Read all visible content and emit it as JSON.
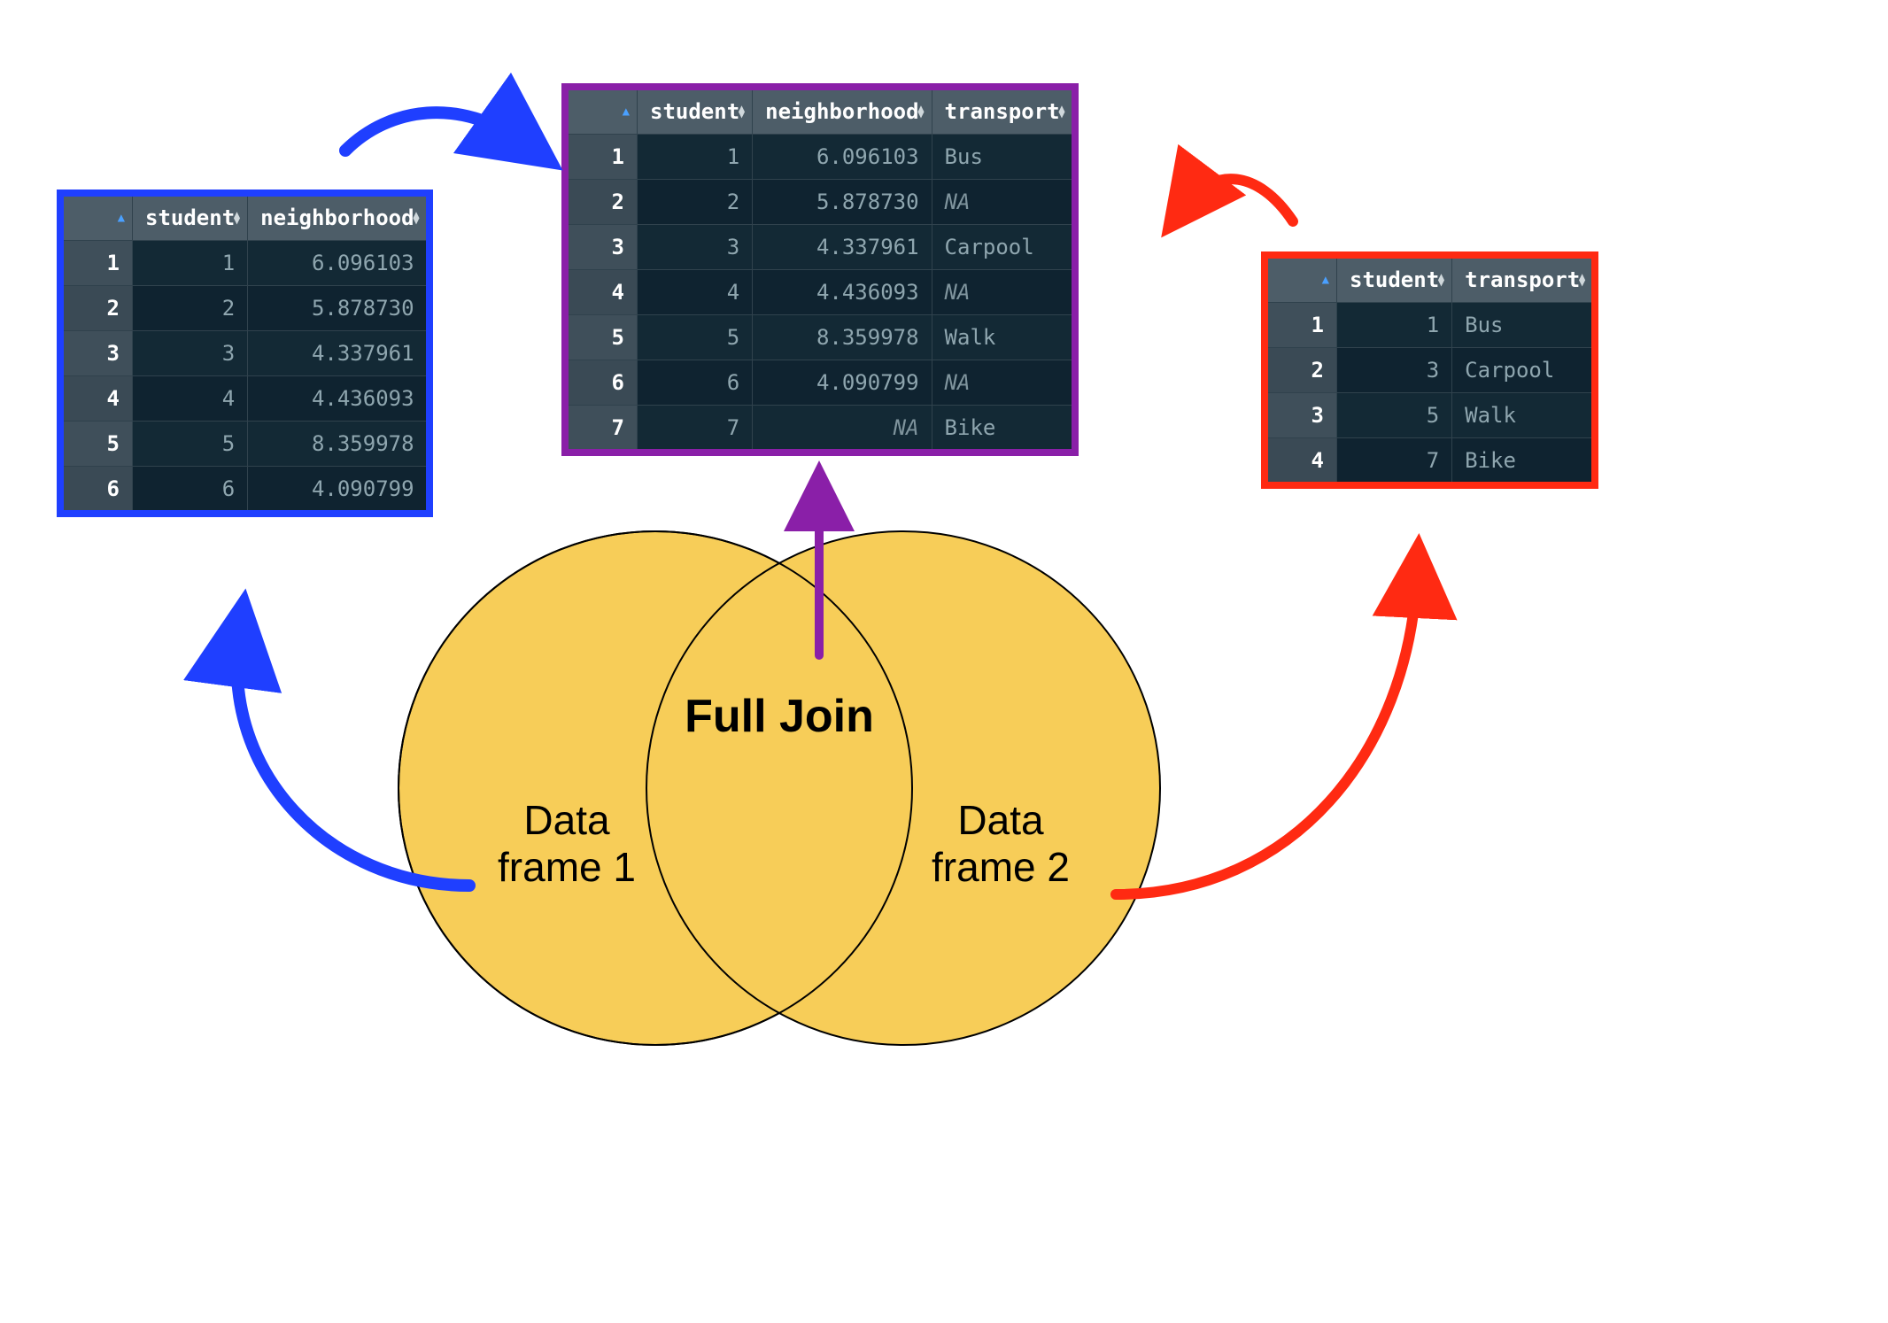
{
  "venn": {
    "center_title": "Full Join",
    "left_label": "Data\nframe 1",
    "right_label": "Data\nframe 2"
  },
  "df1": {
    "columns": [
      "student",
      "neighborhood"
    ],
    "rows": [
      {
        "n": "1",
        "student": "1",
        "neighborhood": "6.096103"
      },
      {
        "n": "2",
        "student": "2",
        "neighborhood": "5.878730"
      },
      {
        "n": "3",
        "student": "3",
        "neighborhood": "4.337961"
      },
      {
        "n": "4",
        "student": "4",
        "neighborhood": "4.436093"
      },
      {
        "n": "5",
        "student": "5",
        "neighborhood": "8.359978"
      },
      {
        "n": "6",
        "student": "6",
        "neighborhood": "4.090799"
      }
    ]
  },
  "df2": {
    "columns": [
      "student",
      "transport"
    ],
    "rows": [
      {
        "n": "1",
        "student": "1",
        "transport": "Bus"
      },
      {
        "n": "2",
        "student": "3",
        "transport": "Carpool"
      },
      {
        "n": "3",
        "student": "5",
        "transport": "Walk"
      },
      {
        "n": "4",
        "student": "7",
        "transport": "Bike"
      }
    ]
  },
  "result": {
    "columns": [
      "student",
      "neighborhood",
      "transport"
    ],
    "rows": [
      {
        "n": "1",
        "student": "1",
        "neighborhood": "6.096103",
        "transport": "Bus",
        "na": false,
        "na_n": false
      },
      {
        "n": "2",
        "student": "2",
        "neighborhood": "5.878730",
        "transport": "NA",
        "na": true,
        "na_n": false
      },
      {
        "n": "3",
        "student": "3",
        "neighborhood": "4.337961",
        "transport": "Carpool",
        "na": false,
        "na_n": false
      },
      {
        "n": "4",
        "student": "4",
        "neighborhood": "4.436093",
        "transport": "NA",
        "na": true,
        "na_n": false
      },
      {
        "n": "5",
        "student": "5",
        "neighborhood": "8.359978",
        "transport": "Walk",
        "na": false,
        "na_n": false
      },
      {
        "n": "6",
        "student": "6",
        "neighborhood": "4.090799",
        "transport": "NA",
        "na": true,
        "na_n": false
      },
      {
        "n": "7",
        "student": "7",
        "neighborhood": "NA",
        "transport": "Bike",
        "na": false,
        "na_n": true
      }
    ]
  },
  "colors": {
    "blue": "#1f3fff",
    "purple": "#8a1fa8",
    "red": "#ff2a12",
    "venn_fill": "#f7cd58"
  }
}
